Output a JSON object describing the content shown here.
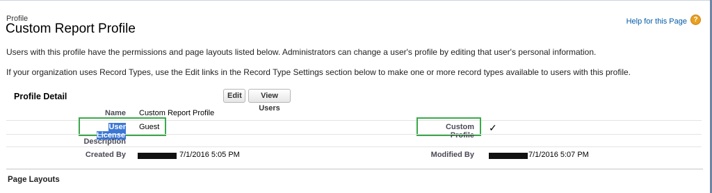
{
  "header": {
    "breadcrumb": "Profile",
    "title": "Custom Report Profile",
    "help_link": "Help for this Page",
    "help_icon_glyph": "?"
  },
  "intro": {
    "line1": "Users with this profile have the permissions and page layouts listed below. Administrators can change a user's profile by editing that user's personal information.",
    "line2": "If your organization uses Record Types, use the Edit links in the Record Type Settings section below to make one or more record types available to users with this profile."
  },
  "profile_detail": {
    "section_title": "Profile Detail",
    "buttons": {
      "edit": "Edit",
      "view_users": "View Users"
    },
    "fields": {
      "name_label": "Name",
      "name_value": "Custom Report Profile",
      "user_license_label": "User License",
      "user_license_value": "Guest",
      "custom_profile_label": "Custom Profile",
      "custom_profile_value": "✓",
      "description_label": "Description",
      "created_by_label": "Created By",
      "created_by_date": "7/1/2016 5:05 PM",
      "modified_by_label": "Modified By",
      "modified_by_date": "7/1/2016 5:07 PM"
    }
  },
  "page_layouts": {
    "section_title": "Page Layouts"
  },
  "colors": {
    "link": "#015ba7",
    "highlight_border": "#3aa84a",
    "selection": "#3b78d6",
    "help_icon": "#e8a020"
  }
}
